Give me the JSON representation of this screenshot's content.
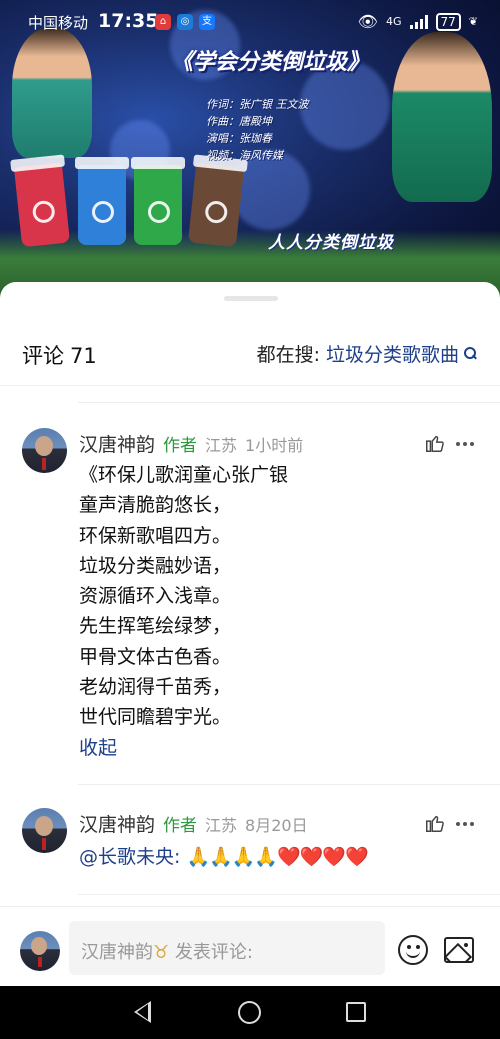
{
  "status_bar": {
    "carrier": "中国移动",
    "time": "17:35",
    "network": "4G",
    "battery": "77"
  },
  "video": {
    "title": "《学会分类倒垃圾》",
    "credits": [
      "作词：张广银 王文波",
      "作曲：唐殿坤",
      "演唱：张珈春",
      "视频：海风传媒"
    ],
    "subtitle": "人人分类倒垃圾"
  },
  "comments_header": {
    "label": "评论",
    "count": "71",
    "search_prefix": "都在搜:",
    "search_term": "垃圾分类歌歌曲"
  },
  "comments": [
    {
      "author": "汉唐神韵",
      "tag": "作者",
      "location": "江苏",
      "time": "1小时前",
      "lines": [
        "《环保儿歌润童心张广银",
        "童声清脆韵悠长，",
        "环保新歌唱四方。",
        "垃圾分类融妙语，",
        "资源循环入浅章。",
        "先生挥笔绘绿梦，",
        "甲骨文体古色香。",
        "老幼润得千苗秀，",
        "世代同瞻碧宇光。"
      ],
      "collapse_label": "收起"
    },
    {
      "author": "汉唐神韵",
      "tag": "作者",
      "location": "江苏",
      "time": "8月20日",
      "mention": "@长歌未央:",
      "emojis": "🙏🙏🙏🙏❤️❤️❤️❤️"
    }
  ],
  "composer": {
    "name": "汉唐神韵",
    "badge": "♉",
    "placeholder": "发表评论:"
  },
  "colors": {
    "link": "#1e3f8a",
    "author_tag": "#2c9a3c"
  }
}
